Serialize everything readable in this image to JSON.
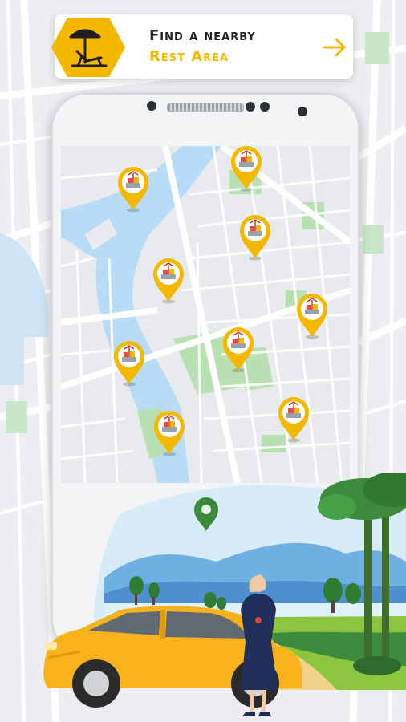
{
  "banner": {
    "title": "Find a nearby",
    "subtitle": "Rest Area",
    "icon": "beach-chair-umbrella-icon",
    "arrow_icon": "arrow-right-icon",
    "accent_color": "#f5b800"
  },
  "map": {
    "pin_icon": "rest-area-marker-icon",
    "pin_color": "#f5b800",
    "location_icon": "location-pin-icon",
    "location_color": "#3a8a3a",
    "rest_area_pins": [
      {
        "id": "pin-1"
      },
      {
        "id": "pin-2"
      },
      {
        "id": "pin-3"
      },
      {
        "id": "pin-4"
      },
      {
        "id": "pin-5"
      },
      {
        "id": "pin-6"
      },
      {
        "id": "pin-7"
      },
      {
        "id": "pin-8"
      },
      {
        "id": "pin-9"
      }
    ]
  },
  "illustration": {
    "vehicle": "yellow-car",
    "person": "woman-with-cup",
    "car_color": "#f7b21c"
  }
}
